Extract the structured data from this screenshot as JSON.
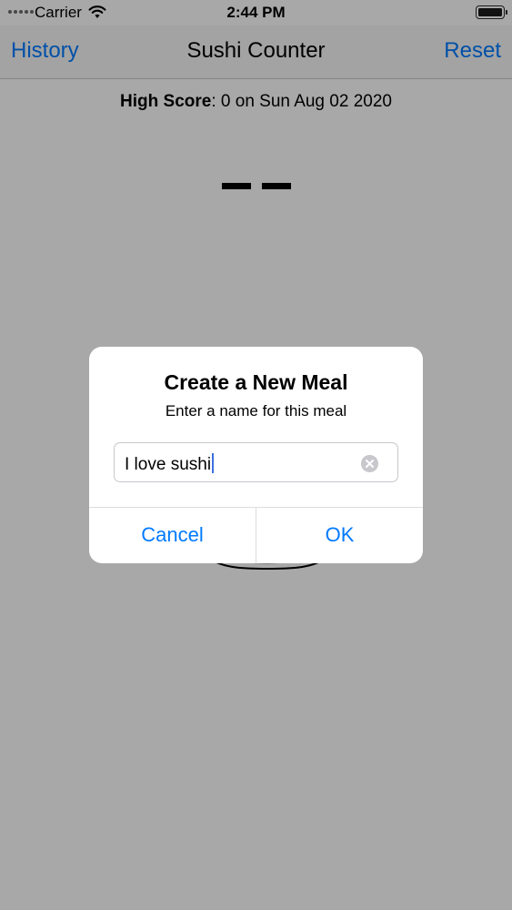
{
  "status_bar": {
    "carrier": "Carrier",
    "time": "2:44 PM"
  },
  "nav": {
    "left_label": "History",
    "title": "Sushi Counter",
    "right_label": "Reset"
  },
  "main": {
    "high_score_label": "High Score",
    "high_score_value": ": 0 on Sun Aug 02 2020"
  },
  "alert": {
    "title": "Create a New Meal",
    "message": "Enter a name for this meal",
    "field_value": "I love sushi",
    "cancel_label": "Cancel",
    "ok_label": "OK"
  },
  "colors": {
    "accent": "#007aff",
    "overlay": "#a8a8a9"
  },
  "icons": [
    "wifi-icon",
    "battery-icon",
    "clear-text-icon",
    "plate-icon"
  ]
}
